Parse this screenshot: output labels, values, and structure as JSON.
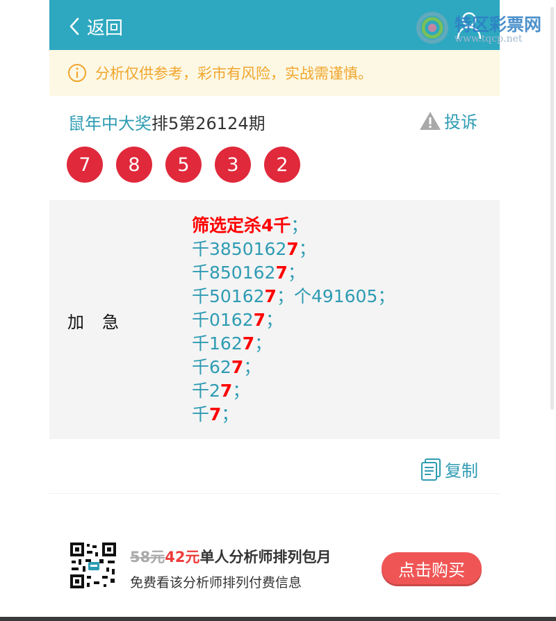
{
  "header": {
    "back_label": "返回"
  },
  "notice": {
    "text": "分析仅供参考，彩市有风险，实战需谨慎。"
  },
  "title": {
    "author": "鼠年中大奖",
    "issue": "排5第26124期",
    "complaint_label": "投诉"
  },
  "balls": [
    "7",
    "8",
    "5",
    "3",
    "2"
  ],
  "content": {
    "label": "加急",
    "lines": [
      {
        "pre": "筛选定杀4千",
        "hit": "",
        "post": "；",
        "style": "red"
      },
      {
        "pre": "千385016",
        "hit": "27",
        "post": "；"
      },
      {
        "pre": "千85016",
        "hit": "27",
        "post": "；"
      },
      {
        "pre": "千5016",
        "hit": "27",
        "post": "；个491605；"
      },
      {
        "pre": "千016",
        "hit": "27",
        "post": "；"
      },
      {
        "pre": "千16",
        "hit": "27",
        "post": "；"
      },
      {
        "pre": "千6",
        "hit": "27",
        "post": "；"
      },
      {
        "pre": "千",
        "hit": "27",
        "post": "；"
      },
      {
        "pre": "千",
        "hit": "7",
        "post": "；"
      }
    ]
  },
  "copy_label": "复制",
  "promo": {
    "old_price": "58元",
    "new_price": "42元",
    "title": "单人分析师排列包月",
    "subtitle": "免费看该分析师排列付费信息",
    "buy_label": "点击购买"
  },
  "watermark": {
    "brand": "特区彩票网",
    "url": "www.tqcp.net"
  },
  "colors": {
    "header": "#2ea8c0",
    "accent": "#2e9bb3",
    "ball": "#e0293b",
    "notice": "#f0a52c",
    "buy": "#f05555"
  }
}
